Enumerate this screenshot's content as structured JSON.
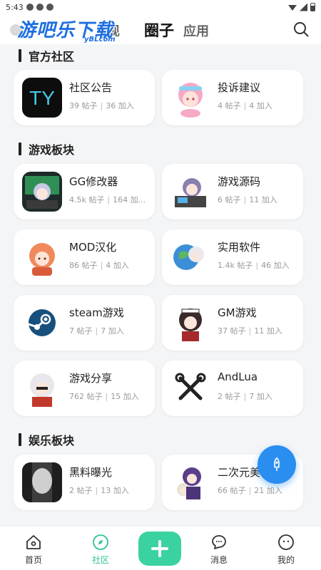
{
  "status_bar": {
    "time": "5:43"
  },
  "watermark": {
    "text": "游吧乐下载",
    "sub": "yBLcom"
  },
  "header": {
    "tabs": [
      {
        "label": "发现",
        "visible_label": "现"
      },
      {
        "label": "圈子",
        "active": true
      },
      {
        "label": "应用"
      }
    ],
    "search_icon": "search-icon"
  },
  "sections": [
    {
      "title": "官方社区",
      "items": [
        {
          "name": "社区公告",
          "posts": "39 帖子",
          "joined": "36 加入",
          "icon": "ty-logo"
        },
        {
          "name": "投诉建议",
          "posts": "4 帖子",
          "joined": "4 加入",
          "icon": "pink-hair-girl-avatar"
        }
      ]
    },
    {
      "title": "游戏板块",
      "items": [
        {
          "name": "GG修改器",
          "posts": "4.5k 帖子",
          "joined": "164 加...",
          "icon": "gamer-girl-avatar"
        },
        {
          "name": "游戏源码",
          "posts": "6 帖子",
          "joined": "11 加入",
          "icon": "coder-girl-avatar"
        },
        {
          "name": "MOD汉化",
          "posts": "86 帖子",
          "joined": "4 加入",
          "icon": "orange-hair-girl-avatar"
        },
        {
          "name": "实用软件",
          "posts": "1.4k 帖子",
          "joined": "46 加入",
          "icon": "globe-girl-avatar"
        },
        {
          "name": "steam游戏",
          "posts": "7 帖子",
          "joined": "7 加入",
          "icon": "steam-logo"
        },
        {
          "name": "GM游戏",
          "posts": "37 帖子",
          "joined": "11 加入",
          "icon": "maid-girl-avatar"
        },
        {
          "name": "游戏分享",
          "posts": "762 帖子",
          "joined": "15 加入",
          "icon": "white-hair-boy-avatar"
        },
        {
          "name": "AndLua",
          "posts": "2 帖子",
          "joined": "7 加入",
          "icon": "tools-icon"
        }
      ]
    },
    {
      "title": "娱乐板块",
      "items": [
        {
          "name": "黑料曝光",
          "posts": "2 帖子",
          "joined": "13 加入",
          "icon": "dark-photo-avatar"
        },
        {
          "name": "二次元美",
          "posts": "66 帖子",
          "joined": "21 加入",
          "icon": "purple-hair-avatar"
        }
      ]
    }
  ],
  "fab": {
    "icon": "rocket-icon"
  },
  "bottom_nav": [
    {
      "label": "首页",
      "icon": "home-icon"
    },
    {
      "label": "社区",
      "icon": "compass-icon",
      "active": true
    },
    {
      "label": "",
      "icon": "plus-icon"
    },
    {
      "label": "消息",
      "icon": "chat-icon"
    },
    {
      "label": "我的",
      "icon": "profile-icon"
    }
  ],
  "colors": {
    "accent": "#3bd2a2",
    "active_tab": "#2fc29a",
    "fab": "#2a8df0",
    "background": "#f4f5f7"
  }
}
